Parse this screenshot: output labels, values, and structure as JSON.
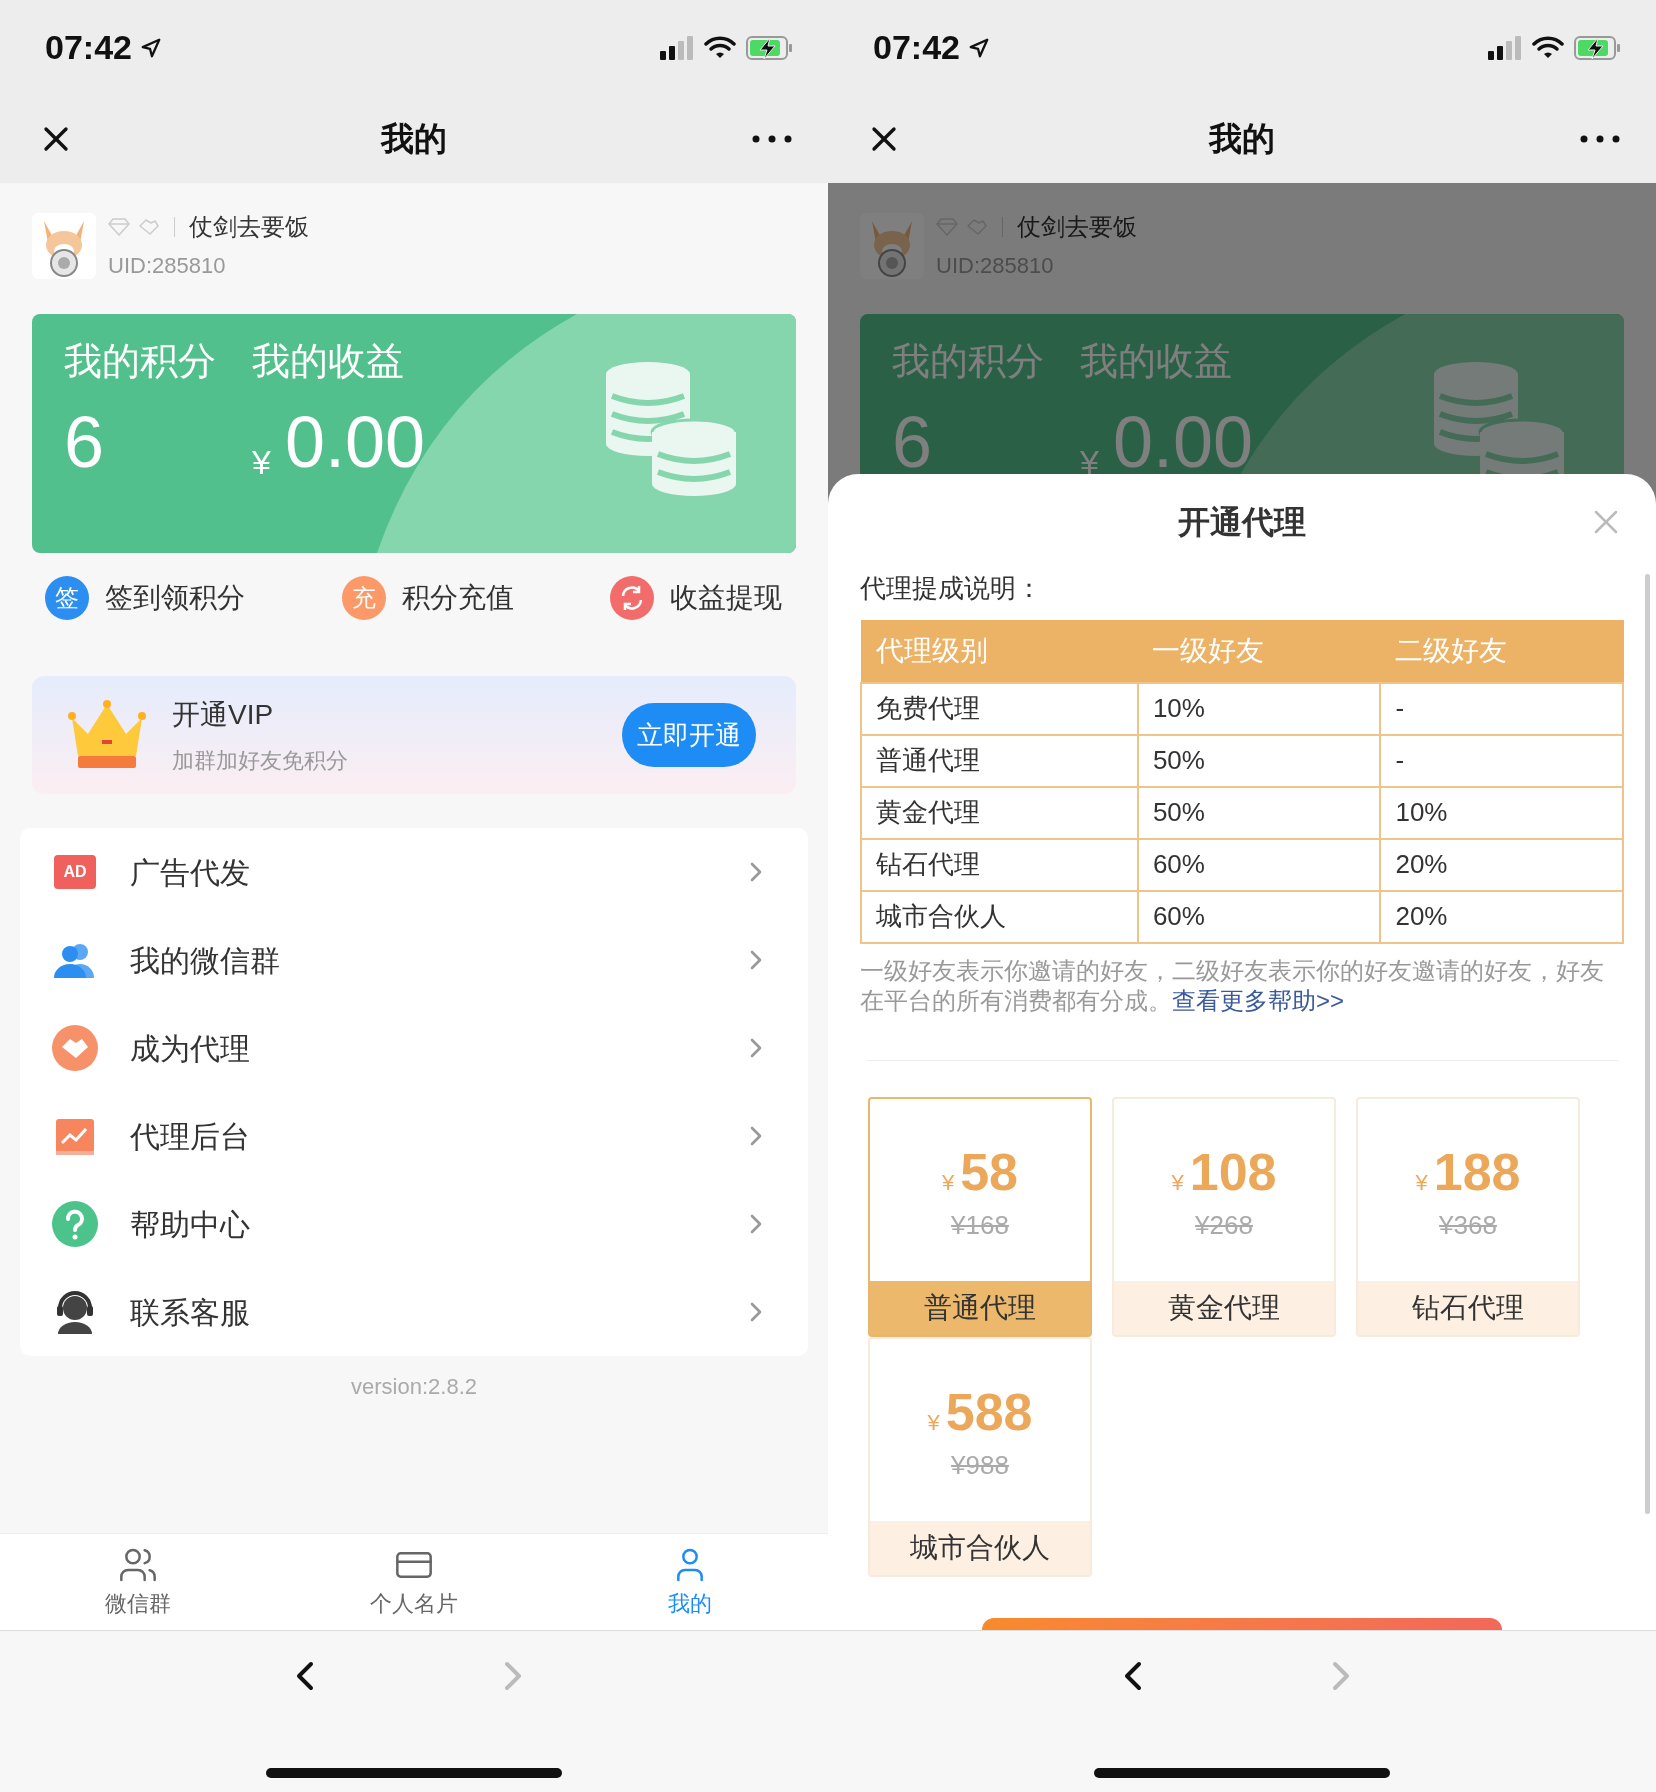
{
  "left": {
    "status_bar": {
      "time": "07:42"
    },
    "nav_bar": {
      "title": "我的"
    },
    "profile": {
      "name": "仗剑去要饭",
      "uid": "UID:285810"
    },
    "points_card": {
      "points_label": "我的积分",
      "points": "6",
      "earnings_label": "我的收益",
      "currency": "¥",
      "earnings": "0.00"
    },
    "actions": [
      {
        "kind": "glyph",
        "icon_text": "签",
        "label": "签到领积分",
        "color": "#2b8ef0"
      },
      {
        "kind": "glyph",
        "icon_text": "充",
        "label": "积分充值",
        "color": "#fb9a68"
      },
      {
        "kind": "exchange",
        "label": "收益提现",
        "color": "#f26c6c"
      }
    ],
    "vip_banner": {
      "title": "开通VIP",
      "subtitle": "加群加好友免积分",
      "button": "立即开通"
    },
    "menu": [
      {
        "kind": "ad",
        "icon_text": "AD",
        "label": "广告代发"
      },
      {
        "kind": "group",
        "label": "我的微信群"
      },
      {
        "kind": "agent",
        "label": "成为代理"
      },
      {
        "kind": "backend",
        "label": "代理后台"
      },
      {
        "kind": "help",
        "label": "帮助中心"
      },
      {
        "kind": "service",
        "label": "联系客服"
      }
    ],
    "version": "version:2.8.2",
    "tab_bar": [
      {
        "kind": "group",
        "label": "微信群",
        "selected": false
      },
      {
        "kind": "card",
        "label": "个人名片",
        "selected": false
      },
      {
        "kind": "me",
        "label": "我的",
        "selected": true
      }
    ],
    "browser_bar": {
      "back_enabled": true,
      "forward_enabled": false
    }
  },
  "right": {
    "status_bar": {
      "time": "07:42"
    },
    "nav_bar": {
      "title": "我的"
    },
    "profile": {
      "name": "仗剑去要饭",
      "uid": "UID:285810"
    },
    "points_card": {
      "points_label": "我的积分",
      "points": "6",
      "earnings_label": "我的收益",
      "currency": "¥",
      "earnings": "0.00"
    },
    "agent_sheet": {
      "title": "开通代理",
      "subtitle": "代理提成说明：",
      "table": {
        "columns": [
          "代理级别",
          "一级好友",
          "二级好友"
        ],
        "rows": [
          [
            "免费代理",
            "10%",
            "-"
          ],
          [
            "普通代理",
            "50%",
            "-"
          ],
          [
            "黄金代理",
            "50%",
            "10%"
          ],
          [
            "钻石代理",
            "60%",
            "20%"
          ],
          [
            "城市合伙人",
            "60%",
            "20%"
          ]
        ]
      },
      "note": "一级好友表示你邀请的好友，二级好友表示你的好友邀请的好友，好友在平台的所有消费都有分成。",
      "help_link": "查看更多帮助>>",
      "plans": [
        {
          "currency": "¥",
          "price": "58",
          "original_price": "¥168",
          "name": "普通代理",
          "selected": true
        },
        {
          "currency": "¥",
          "price": "108",
          "original_price": "¥268",
          "name": "黄金代理",
          "selected": false
        },
        {
          "currency": "¥",
          "price": "188",
          "original_price": "¥368",
          "name": "钻石代理",
          "selected": false
        },
        {
          "currency": "¥",
          "price": "588",
          "original_price": "¥988",
          "name": "城市合伙人",
          "selected": false
        }
      ]
    },
    "browser_bar": {
      "back_enabled": true,
      "forward_enabled": false
    }
  }
}
